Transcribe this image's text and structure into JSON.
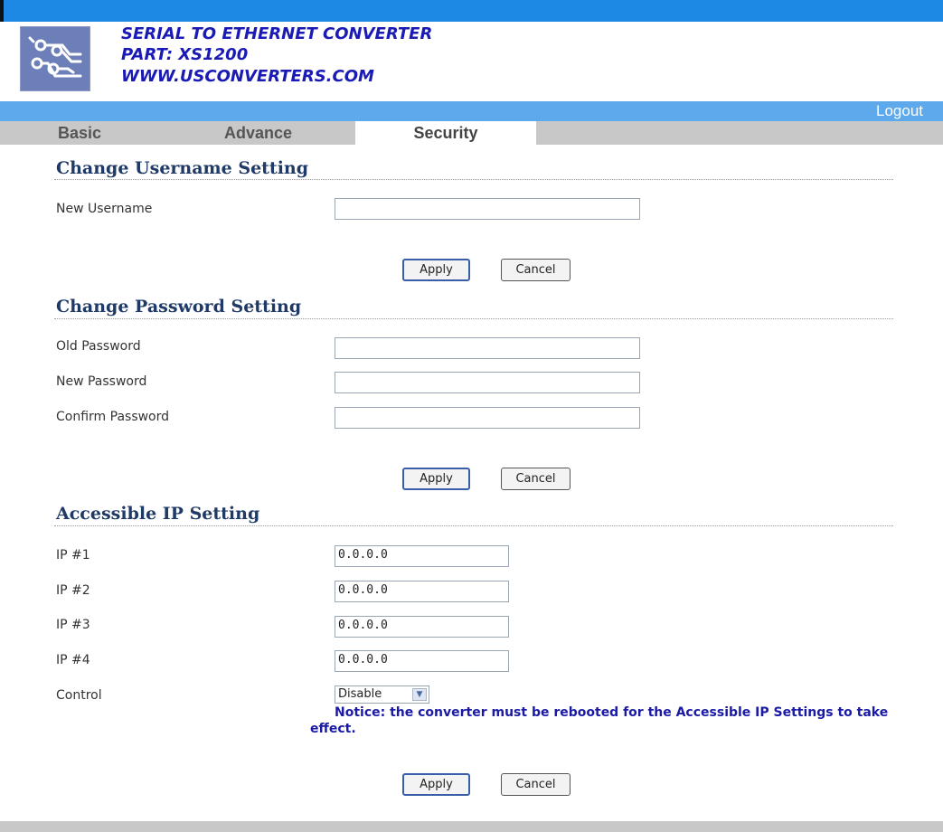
{
  "header": {
    "line1": "SERIAL TO ETHERNET CONVERTER",
    "line2": "PART: XS1200",
    "line3": "WWW.USCONVERTERS.COM"
  },
  "logout": "Logout",
  "tabs": [
    {
      "label": "Basic"
    },
    {
      "label": "Advance"
    },
    {
      "label": "Security",
      "active": true
    }
  ],
  "username_section": {
    "title": "Change Username Setting",
    "new_username_label": "New Username",
    "new_username_value": ""
  },
  "password_section": {
    "title": "Change Password Setting",
    "old_label": "Old Password",
    "new_label": "New Password",
    "confirm_label": "Confirm Password"
  },
  "ip_section": {
    "title": "Accessible IP Setting",
    "ips": [
      {
        "label": "IP #1",
        "value": "0.0.0.0"
      },
      {
        "label": "IP #2",
        "value": "0.0.0.0"
      },
      {
        "label": "IP #3",
        "value": "0.0.0.0"
      },
      {
        "label": "IP #4",
        "value": "0.0.0.0"
      }
    ],
    "control_label": "Control",
    "control_value": "Disable",
    "notice_line1": "Notice: the converter must be rebooted for the Accessible IP Settings to take",
    "notice_line2": "effect."
  },
  "buttons": {
    "apply": "Apply",
    "cancel": "Cancel"
  },
  "colors": {
    "top_bar": "#1e88e5",
    "header_text": "#1a1ab5",
    "section_title": "#1f3a66",
    "tab_bar": "#c8c8c8",
    "notice": "#1a1aa6"
  },
  "icons": {
    "logo": "circuit-logo-icon",
    "dropdown": "chevron-down-icon"
  }
}
